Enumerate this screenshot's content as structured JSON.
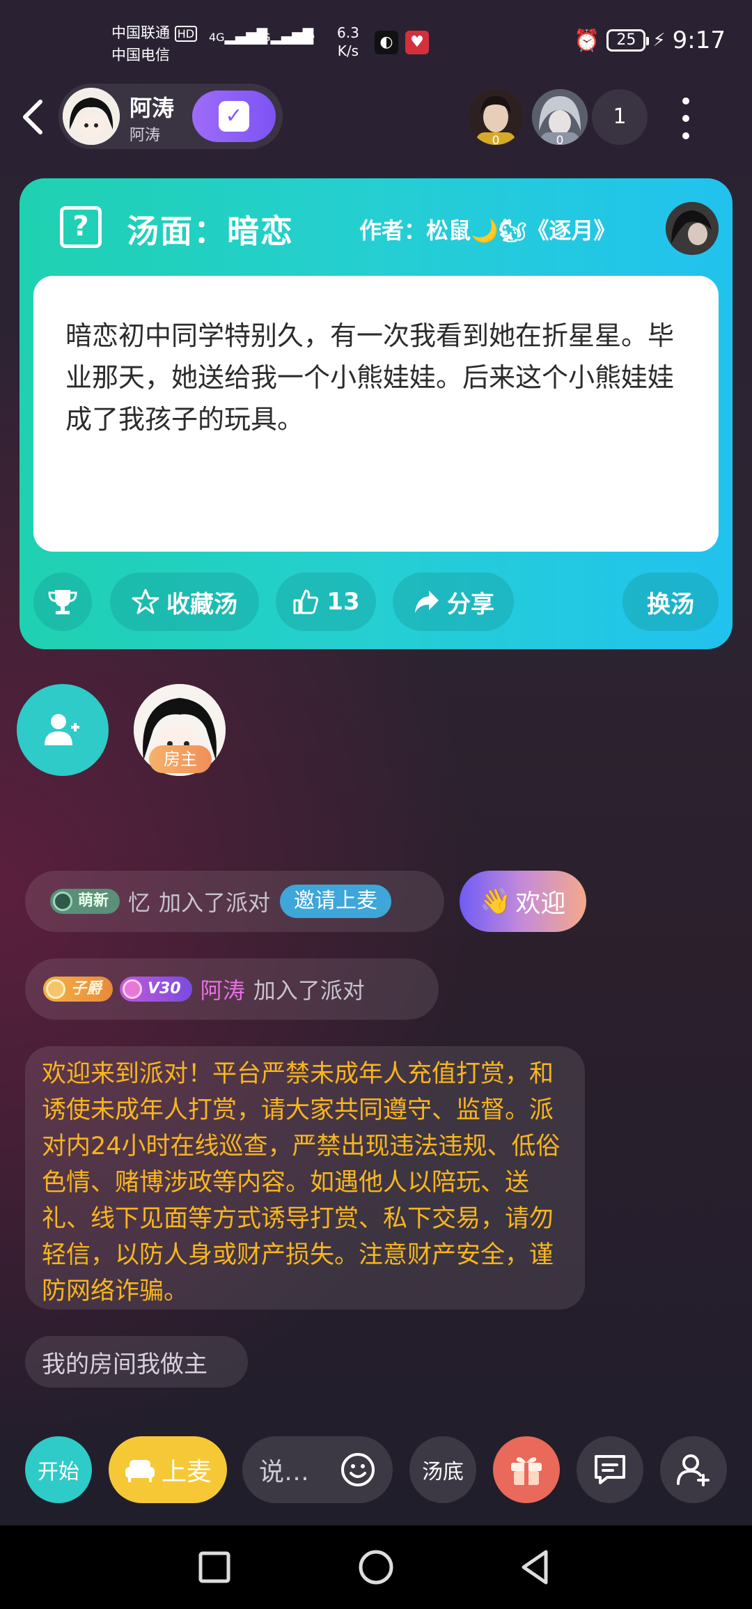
{
  "status_bar": {
    "carrier1": "中国联通",
    "carrier1_badge": "HD",
    "carrier2": "中国电信",
    "net1": "4G",
    "net2": "2G",
    "speed_value": "6.3",
    "speed_unit": "K/s",
    "battery": "25",
    "time": "9:17"
  },
  "header": {
    "host_name": "阿涛",
    "host_sub": "阿涛",
    "top_users": [
      {
        "score": "0"
      },
      {
        "score": "0"
      }
    ],
    "online_count": "1"
  },
  "card": {
    "title": "汤面：暗恋",
    "author": "作者：松鼠🌙🐿《逐月》",
    "text": "暗恋初中同学特别久，有一次我看到她在折星星。毕业那天，她送给我一个小熊娃娃。后来这个小熊娃娃成了我孩子的玩具。",
    "collect_label": "收藏汤",
    "like_count": "13",
    "share_label": "分享",
    "change_label": "换汤"
  },
  "seats": {
    "owner_tag": "房主"
  },
  "chat": {
    "msg1": {
      "badge": "萌新",
      "name": "忆",
      "text": "加入了派对",
      "invite_label": "邀请上麦"
    },
    "welcome_label": "欢迎",
    "msg2": {
      "badge1": "子爵",
      "badge2": "V30",
      "name": "阿涛",
      "text": "加入了派对"
    },
    "notice": "欢迎来到派对！平台严禁未成年人充值打赏，和诱使未成年人打赏，请大家共同遵守、监督。派对内24小时在线巡查，严禁出现违法违规、低俗色情、赌博涉政等内容。如遇他人以陪玩、送礼、线下见面等方式诱导打赏、私下交易，请勿轻信，以防人身或财产损失。注意财产安全，谨防网络诈骗。",
    "msg3": "我的房间我做主"
  },
  "toolbar": {
    "start_label": "开始",
    "mic_label": "上麦",
    "say_placeholder": "说…",
    "bottom_label": "汤底"
  },
  "colors": {
    "card_start": "#1fd1b0",
    "card_end": "#21c2ef",
    "notice_text": "#f7b51f",
    "mic_button": "#f6c836",
    "teal": "#2ecbc8"
  }
}
